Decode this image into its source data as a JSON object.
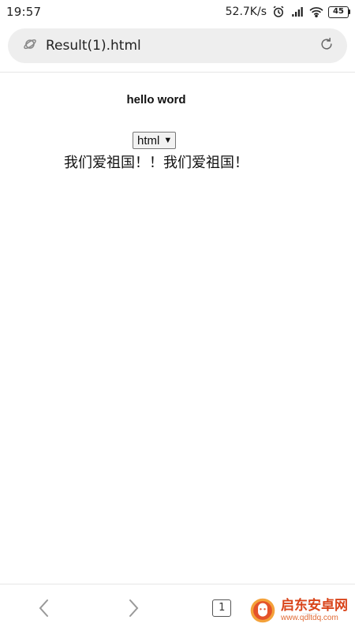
{
  "status_bar": {
    "time": "19:57",
    "net_speed": "52.7K/s",
    "battery": "45"
  },
  "address_bar": {
    "url": "Result(1).html"
  },
  "page": {
    "heading": "hello word",
    "select_value": "html",
    "paragraph": "我们爱祖国！！我们爱祖国！"
  },
  "bottom_nav": {
    "tab_count": "1"
  },
  "watermark": {
    "title": "启东安卓网",
    "url": "www.qdltdq.com"
  },
  "colors": {
    "address_bar_bg": "#eeeeee",
    "watermark_orange": "#d9441a"
  }
}
